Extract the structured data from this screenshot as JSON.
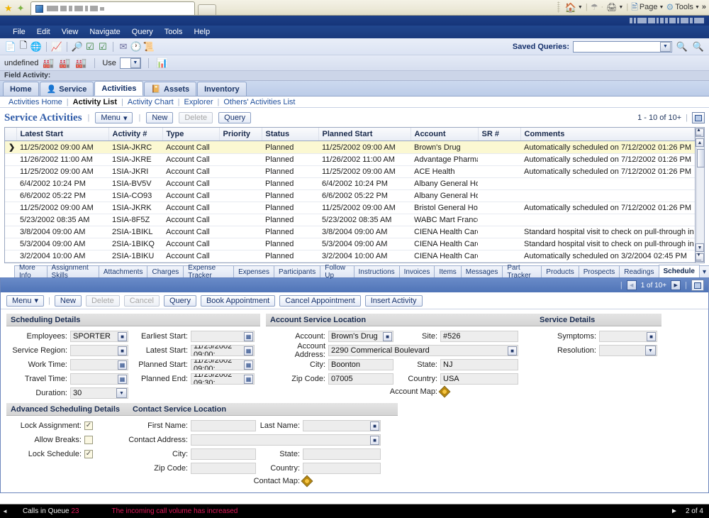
{
  "browser": {
    "favorites_icon": "star-icon",
    "add_favorite_icon": "add-favorite-icon",
    "tab_new_label": "",
    "controls": [
      {
        "icon": "home-icon",
        "label": ""
      },
      {
        "icon": "rss-feed-icon",
        "label": ""
      },
      {
        "icon": "print-icon",
        "label": ""
      },
      {
        "icon": "page-icon",
        "label": "Page"
      },
      {
        "icon": "tools-gear-icon",
        "label": "Tools"
      }
    ],
    "overflow_label": "»"
  },
  "app": {
    "logo_alt": "ORACLE",
    "menus": [
      "File",
      "Edit",
      "View",
      "Navigate",
      "Query",
      "Tools",
      "Help"
    ],
    "toolbar1_icons": [
      "new-record-icon",
      "copy-record-icon",
      "site-map-icon",
      "edit-chart-icon",
      "query-binoculars-icon",
      "execute-query-icon",
      "refine-query-icon",
      "send-email-icon",
      "history-clock-icon",
      "reports-icon"
    ],
    "toolbar2": {
      "status_text": "undefined",
      "icons": [
        "activity-plan-icon",
        "new-activity-icon",
        "activity-chart-icon"
      ],
      "use_label": "Use",
      "use_value": "",
      "last_icon": "chart-icon"
    },
    "saved_queries": {
      "label": "Saved Queries:",
      "value": "",
      "placeholder": "",
      "execute_icon": "execute-query-icon",
      "new_query_icon": "new-query-icon"
    },
    "field_activity_label": "Field Activity:"
  },
  "screen_tabs": [
    {
      "label": "Home",
      "icon": null,
      "active": false
    },
    {
      "label": "Service",
      "icon": "person-icon",
      "active": false
    },
    {
      "label": "Activities",
      "icon": null,
      "active": true
    },
    {
      "label": "Assets",
      "icon": "book-icon",
      "active": false
    },
    {
      "label": "Inventory",
      "icon": null,
      "active": false
    }
  ],
  "view_links": [
    {
      "label": "Activities Home",
      "active": false
    },
    {
      "label": "Activity List",
      "active": true
    },
    {
      "label": "Activity Chart",
      "active": false
    },
    {
      "label": "Explorer",
      "active": false
    },
    {
      "label": "Others' Activities List",
      "active": false
    }
  ],
  "list_applet": {
    "title": "Service Activities",
    "menu_label": "Menu",
    "menu_caret": "▾",
    "new_label": "New",
    "delete_label": "Delete",
    "query_label": "Query",
    "record_count": "1 - 10 of 10+",
    "columns": [
      "Latest Start",
      "Activity #",
      "Type",
      "Priority",
      "Status",
      "Planned Start",
      "Account",
      "SR #",
      "Comments"
    ],
    "rows": [
      {
        "selected": true,
        "latest_start": "11/25/2002 09:00 AM",
        "activity": "1SIA-JKRC",
        "type": "Account Call",
        "priority": "",
        "status": "Planned",
        "planned_start": "11/25/2002 09:00 AM",
        "account": "Brown's Drug",
        "sr": "",
        "comments": "Automatically scheduled on 7/12/2002 01:26 PM"
      },
      {
        "selected": false,
        "latest_start": "11/26/2002 11:00 AM",
        "activity": "1SIA-JKRE",
        "type": "Account Call",
        "priority": "",
        "status": "Planned",
        "planned_start": "11/26/2002 11:00 AM",
        "account": "Advantage Pharmac",
        "sr": "",
        "comments": "Automatically scheduled on 7/12/2002 01:26 PM"
      },
      {
        "selected": false,
        "latest_start": "11/25/2002 09:00 AM",
        "activity": "1SIA-JKRI",
        "type": "Account Call",
        "priority": "",
        "status": "Planned",
        "planned_start": "11/25/2002 09:00 AM",
        "account": "ACE Health",
        "sr": "",
        "comments": "Automatically scheduled on 7/12/2002 01:26 PM"
      },
      {
        "selected": false,
        "latest_start": "6/4/2002 10:24 PM",
        "activity": "1SIA-BV5V",
        "type": "Account Call",
        "priority": "",
        "status": "Planned",
        "planned_start": "6/4/2002 10:24 PM",
        "account": "Albany General Hosp",
        "sr": "",
        "comments": ""
      },
      {
        "selected": false,
        "latest_start": "6/6/2002 05:22 PM",
        "activity": "1SIA-CO93",
        "type": "Account Call",
        "priority": "",
        "status": "Planned",
        "planned_start": "6/6/2002 05:22 PM",
        "account": "Albany General Hosp",
        "sr": "",
        "comments": ""
      },
      {
        "selected": false,
        "latest_start": "11/25/2002 09:00 AM",
        "activity": "1SIA-JKRK",
        "type": "Account Call",
        "priority": "",
        "status": "Planned",
        "planned_start": "11/25/2002 09:00 AM",
        "account": "Bristol General Hosp",
        "sr": "",
        "comments": "Automatically scheduled on 7/12/2002 01:26 PM"
      },
      {
        "selected": false,
        "latest_start": "5/23/2002 08:35 AM",
        "activity": "1SIA-8F5Z",
        "type": "Account Call",
        "priority": "",
        "status": "Planned",
        "planned_start": "5/23/2002 08:35 AM",
        "account": "WABC Mart France S",
        "sr": "",
        "comments": ""
      },
      {
        "selected": false,
        "latest_start": "3/8/2004 09:00 AM",
        "activity": "2SIA-1BIKL",
        "type": "Account Call",
        "priority": "",
        "status": "Planned",
        "planned_start": "3/8/2004 09:00 AM",
        "account": "CIENA Health Care",
        "sr": "",
        "comments": "Standard hospital visit to check on pull-through in all three therapeutic"
      },
      {
        "selected": false,
        "latest_start": "5/3/2004 09:00 AM",
        "activity": "2SIA-1BIKQ",
        "type": "Account Call",
        "priority": "",
        "status": "Planned",
        "planned_start": "5/3/2004 09:00 AM",
        "account": "CIENA Health Care",
        "sr": "",
        "comments": "Standard hospital visit to check on pull-through in all three therapeutic"
      },
      {
        "selected": false,
        "latest_start": "3/2/2004 10:00 AM",
        "activity": "2SIA-1BIKU",
        "type": "Account Call",
        "priority": "",
        "status": "Planned",
        "planned_start": "3/2/2004 10:00 AM",
        "account": "CIENA Health Care -",
        "sr": "",
        "comments": "Automatically scheduled on 3/2/2004 02:45 PM"
      }
    ]
  },
  "detail_tabs": [
    {
      "label": "More Info",
      "active": false
    },
    {
      "label": "Assignment Skills",
      "active": false
    },
    {
      "label": "Attachments",
      "active": false
    },
    {
      "label": "Charges",
      "active": false
    },
    {
      "label": "Expense Tracker",
      "active": false
    },
    {
      "label": "Expenses",
      "active": false
    },
    {
      "label": "Participants",
      "active": false
    },
    {
      "label": "Follow Up",
      "active": false
    },
    {
      "label": "Instructions",
      "active": false
    },
    {
      "label": "Invoices",
      "active": false
    },
    {
      "label": "Items",
      "active": false
    },
    {
      "label": "Messages",
      "active": false
    },
    {
      "label": "Part Tracker",
      "active": false
    },
    {
      "label": "Products",
      "active": false
    },
    {
      "label": "Prospects",
      "active": false
    },
    {
      "label": "Readings",
      "active": false
    },
    {
      "label": "Schedule",
      "active": true
    }
  ],
  "detail_tabs_more_caret": "▾",
  "form_applet": {
    "record_count": "1 of 10+",
    "prev_icon": "prev-record-icon",
    "next_icon": "next-record-icon",
    "maximize_icon": "toggle-applet-icon",
    "toolbar": {
      "menu_label": "Menu",
      "menu_caret": "▾",
      "new_label": "New",
      "delete_label": "Delete",
      "cancel_label": "Cancel",
      "query_label": "Query",
      "book_appointment_label": "Book Appointment",
      "cancel_appointment_label": "Cancel Appointment",
      "insert_activity_label": "Insert Activity"
    },
    "scheduling_details": {
      "title": "Scheduling Details",
      "employees_label": "Employees:",
      "employees_value": "SPORTER",
      "service_region_label": "Service Region:",
      "service_region_value": "",
      "work_time_label": "Work Time:",
      "work_time_value": "",
      "travel_time_label": "Travel Time:",
      "travel_time_value": "",
      "duration_label": "Duration:",
      "duration_value": "30",
      "earliest_start_label": "Earliest Start:",
      "earliest_start_value": "",
      "latest_start_label": "Latest Start:",
      "latest_start_value": "11/25/2002 09:00:",
      "planned_start_label": "Planned Start:",
      "planned_start_value": "11/25/2002 09:00:",
      "planned_end_label": "Planned End:",
      "planned_end_value": "11/25/2002 09:30:"
    },
    "account_service_location": {
      "title": "Account Service Location",
      "account_label": "Account:",
      "account_value": "Brown's Drug",
      "site_label": "Site:",
      "site_value": "#526",
      "account_address_label": "Account Address:",
      "account_address_value": "2290 Commerical Boulevard",
      "city_label": "City:",
      "city_value": "Boonton",
      "state_label": "State:",
      "state_value": "NJ",
      "zip_label": "Zip Code:",
      "zip_value": "07005",
      "country_label": "Country:",
      "country_value": "USA",
      "map_label": "Account Map:",
      "map_icon": "map-marker-icon"
    },
    "service_details": {
      "title": "Service Details",
      "symptoms_label": "Symptoms:",
      "symptoms_value": "",
      "resolution_label": "Resolution:",
      "resolution_value": ""
    },
    "advanced_scheduling_details": {
      "title": "Advanced Scheduling Details",
      "lock_assignment_label": "Lock Assignment:",
      "lock_assignment_checked": true,
      "allow_breaks_label": "Allow Breaks:",
      "allow_breaks_checked": false,
      "lock_schedule_label": "Lock Schedule:",
      "lock_schedule_checked": true
    },
    "contact_service_location": {
      "title": "Contact Service Location",
      "first_name_label": "First Name:",
      "first_name_value": "",
      "last_name_label": "Last Name:",
      "last_name_value": "",
      "contact_address_label": "Contact Address:",
      "contact_address_value": "",
      "city_label": "City:",
      "city_value": "",
      "state_label": "State:",
      "state_value": "",
      "zip_label": "Zip Code:",
      "zip_value": "",
      "country_label": "Country:",
      "country_value": "",
      "map_label": "Contact Map:",
      "map_icon": "map-marker-icon"
    }
  },
  "statusbar": {
    "prev_icon": "◄",
    "next_icon": "►",
    "metric_label": "Calls in Queue",
    "metric_value": "23",
    "message": "The incoming call volume has increased",
    "page_indicator": "2 of 4"
  },
  "colors": {
    "title_blue": "#1c3f86",
    "menu_blue": "#21478f",
    "accent_link": "#1f4e9b",
    "selected_row": "#fbf8d2",
    "applet_title": "#2f5ba8",
    "status_red": "#e0195a",
    "form_band": "#5f7fbd"
  }
}
